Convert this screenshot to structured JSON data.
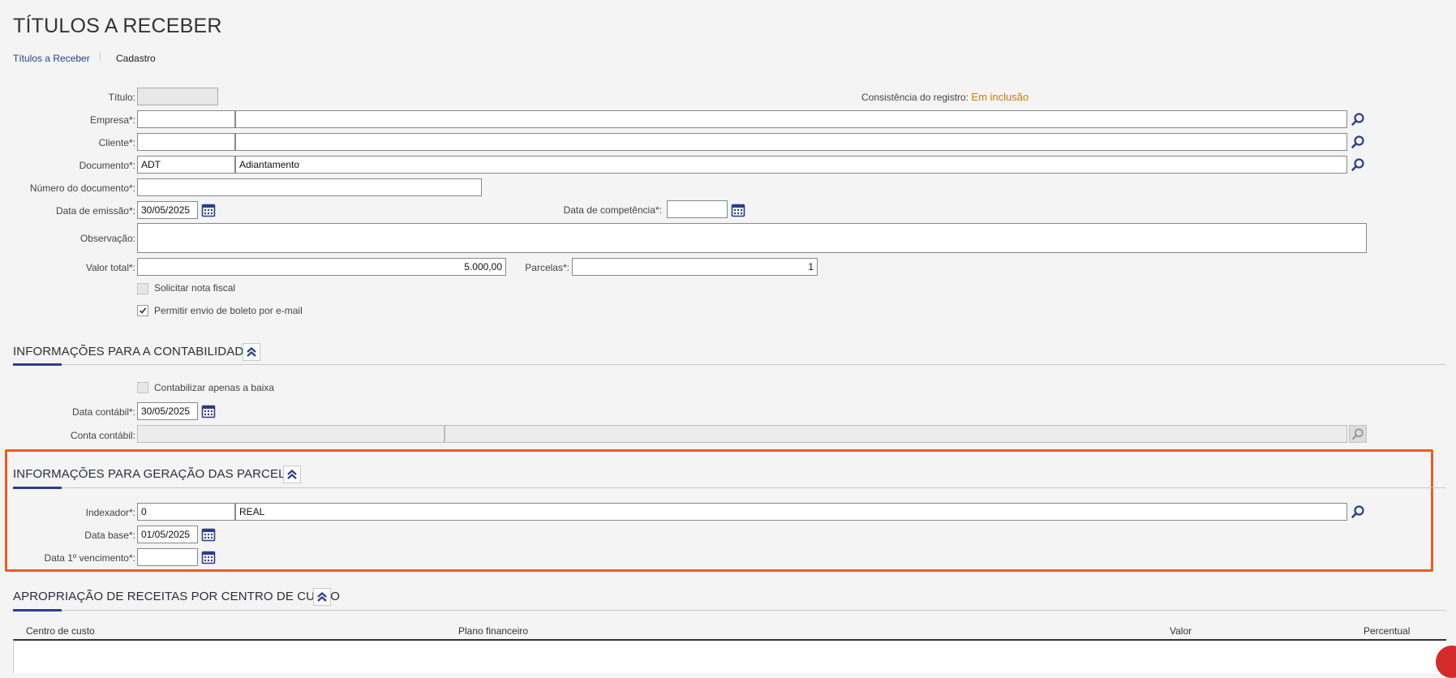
{
  "page": {
    "title": "TÍTULOS A RECEBER",
    "breadcrumb": {
      "link": "Títulos a Receber",
      "current": "Cadastro"
    }
  },
  "form": {
    "titulo": {
      "label": "Título:",
      "value": ""
    },
    "consistencia": {
      "label": "Consistência do registro:",
      "value": "Em inclusão"
    },
    "empresa": {
      "label": "Empresa*:",
      "code": "",
      "name": ""
    },
    "cliente": {
      "label": "Cliente*:",
      "code": "",
      "name": ""
    },
    "documento": {
      "label": "Documento*:",
      "code": "ADT",
      "name": "Adiantamento"
    },
    "numero_documento": {
      "label": "Número do documento*:",
      "value": ""
    },
    "data_emissao": {
      "label": "Data de emissão*:",
      "value": "30/05/2025"
    },
    "data_competencia": {
      "label": "Data de competência*:",
      "value": ""
    },
    "observacao": {
      "label": "Observação:",
      "value": ""
    },
    "valor_total": {
      "label": "Valor total*:",
      "value": "5.000,00"
    },
    "parcelas": {
      "label": "Parcelas*:",
      "value": "1"
    },
    "solicitar_nota": {
      "label": "Solicitar nota fiscal",
      "checked": false,
      "disabled": true
    },
    "permitir_boleto": {
      "label": "Permitir envio de boleto por e-mail",
      "checked": true
    }
  },
  "contabilidade": {
    "title": "INFORMAÇÕES PARA A CONTABILIDADE",
    "contabilizar": {
      "label": "Contabilizar apenas a baixa",
      "checked": false,
      "disabled": true
    },
    "data_contabil": {
      "label": "Data contábil*:",
      "value": "30/05/2025"
    },
    "conta_contabil": {
      "label": "Conta contábil:",
      "code": "",
      "name": ""
    }
  },
  "parcelas_section": {
    "title": "INFORMAÇÕES PARA GERAÇÃO DAS PARCELAS",
    "indexador": {
      "label": "Indexador*:",
      "code": "0",
      "name": "REAL"
    },
    "data_base": {
      "label": "Data base*:",
      "value": "01/05/2025"
    },
    "data_vencimento": {
      "label": "Data 1º vencimento*:",
      "value": ""
    }
  },
  "apropriacao": {
    "title": "APROPRIAÇÃO DE RECEITAS POR CENTRO DE CUSTO",
    "columns": [
      "Centro de custo",
      "Plano financeiro",
      "Valor",
      "Percentual"
    ]
  },
  "colors": {
    "accent": "#2c3e8a",
    "highlight": "#f15a1f",
    "status": "#d4780e"
  }
}
